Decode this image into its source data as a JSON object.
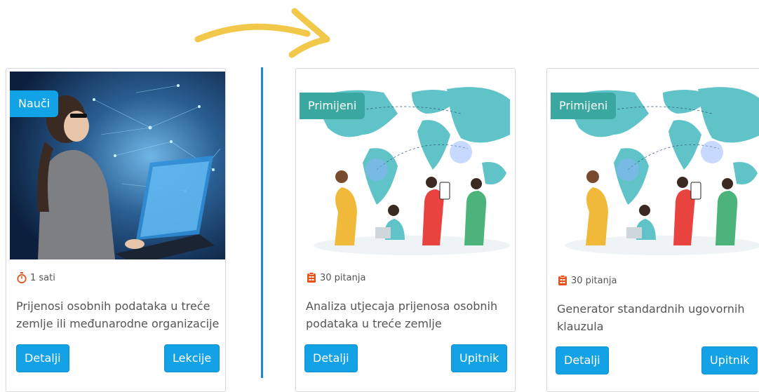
{
  "colors": {
    "learn": "#12a2e6",
    "apply": "#3aa8a0",
    "button": "#14a2e6",
    "divider": "#1e88c8",
    "arrow": "#f2c84b"
  },
  "cards": [
    {
      "badge": "Nauči",
      "meta": "1 sati",
      "meta_icon": "stopwatch-icon",
      "title": "Prijenosi osobnih podataka u treće zemlje ili međunarodne organizacije",
      "btn_left": "Detalji",
      "btn_right": "Lekcije"
    },
    {
      "badge": "Primijeni",
      "meta": "30 pitanja",
      "meta_icon": "clipboard-icon",
      "title": "Analiza utjecaja prijenosa osobnih podataka u treće zemlje",
      "btn_left": "Detalji",
      "btn_right": "Upitnik"
    },
    {
      "badge": "Primijeni",
      "meta": "30 pitanja",
      "meta_icon": "clipboard-icon",
      "title": "Generator standardnih ugovornih klauzula",
      "btn_left": "Detalji",
      "btn_right": "Upitnik"
    }
  ]
}
